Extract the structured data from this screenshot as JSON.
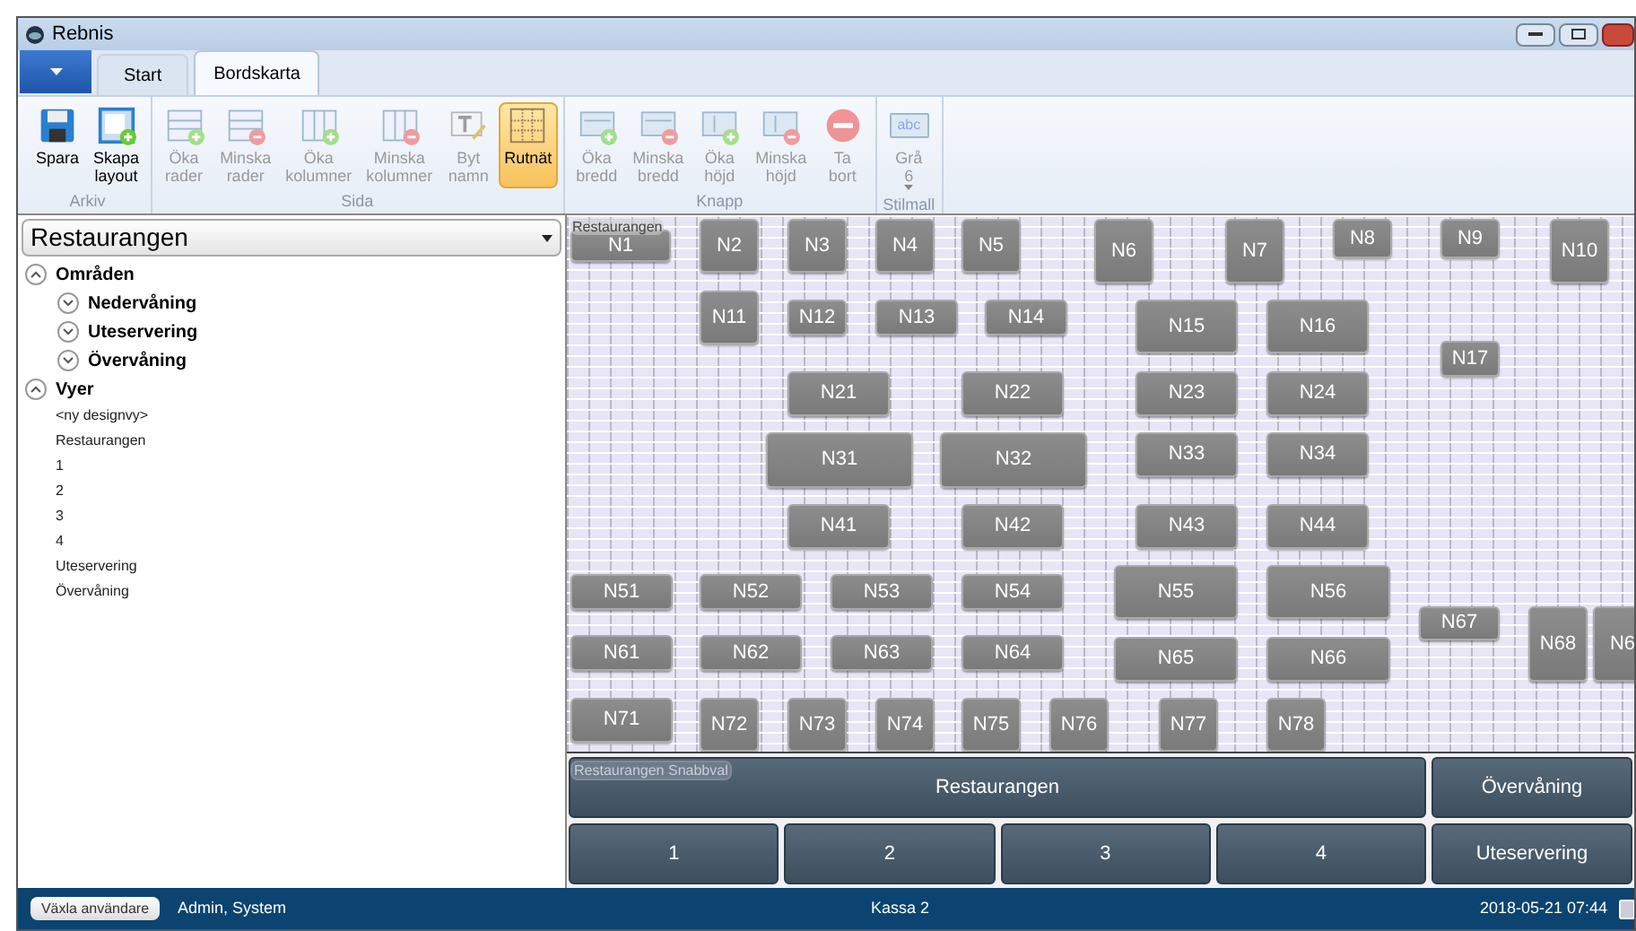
{
  "window": {
    "title": "Rebnis"
  },
  "tabs": [
    {
      "label": "Start",
      "selected": false
    },
    {
      "label": "Bordskarta",
      "selected": true
    }
  ],
  "ribbon": [
    {
      "group": "Arkiv",
      "buttons": [
        {
          "kind": "save",
          "lines": [
            "Spara"
          ],
          "disabled": false,
          "on": false
        },
        {
          "kind": "layout",
          "lines": [
            "Skapa",
            "layout"
          ],
          "disabled": false,
          "on": false
        }
      ]
    },
    {
      "group": "Sida",
      "buttons": [
        {
          "kind": "addrow",
          "lines": [
            "Öka",
            "rader"
          ],
          "disabled": true,
          "on": false
        },
        {
          "kind": "delrow",
          "lines": [
            "Minska",
            "rader"
          ],
          "disabled": true,
          "on": false
        },
        {
          "kind": "addcol",
          "lines": [
            "Öka",
            "kolumner"
          ],
          "disabled": true,
          "on": false
        },
        {
          "kind": "delcol",
          "lines": [
            "Minska",
            "kolumner"
          ],
          "disabled": true,
          "on": false
        },
        {
          "kind": "rename",
          "lines": [
            "Byt",
            "namn"
          ],
          "disabled": true,
          "on": false
        },
        {
          "kind": "grid",
          "lines": [
            "Rutnät"
          ],
          "disabled": false,
          "on": true
        }
      ]
    },
    {
      "group": "Knapp",
      "buttons": [
        {
          "kind": "addw",
          "lines": [
            "Öka",
            "bredd"
          ],
          "disabled": true,
          "on": false
        },
        {
          "kind": "delw",
          "lines": [
            "Minska",
            "bredd"
          ],
          "disabled": true,
          "on": false
        },
        {
          "kind": "addh",
          "lines": [
            "Öka",
            "höjd"
          ],
          "disabled": true,
          "on": false
        },
        {
          "kind": "delh",
          "lines": [
            "Minska",
            "höjd"
          ],
          "disabled": true,
          "on": false
        },
        {
          "kind": "remove",
          "lines": [
            "Ta",
            "bort"
          ],
          "disabled": true,
          "on": false
        }
      ]
    },
    {
      "group": "Stilmall",
      "buttons": [
        {
          "kind": "style",
          "icon_text": "abc",
          "lines": [
            "Grå",
            "6"
          ],
          "disabled": true,
          "on": false,
          "dropdown": true
        }
      ]
    }
  ],
  "area_select": {
    "value": "Restaurangen"
  },
  "tree": [
    {
      "label": "Områden",
      "expanded": true,
      "children": [
        {
          "label": "Nedervåning",
          "expanded": false
        },
        {
          "label": "Uteservering",
          "expanded": false
        },
        {
          "label": "Övervåning",
          "expanded": false
        }
      ]
    },
    {
      "label": "Vyer",
      "expanded": true,
      "items": [
        "<ny designvy>",
        "Restaurangen",
        "1",
        "2",
        "3",
        "4",
        "Uteservering",
        "Övervåning"
      ]
    }
  ],
  "canvas": {
    "area_label": "Restaurangen",
    "tables": [
      "N1",
      "N2",
      "N3",
      "N4",
      "N5",
      "N6",
      "N7",
      "N8",
      "N9",
      "N10",
      "N11",
      "N12",
      "N13",
      "N14",
      "N15",
      "N16",
      "N17",
      "N21",
      "N22",
      "N23",
      "N24",
      "N31",
      "N32",
      "N33",
      "N34",
      "N41",
      "N42",
      "N43",
      "N44",
      "N51",
      "N52",
      "N53",
      "N54",
      "N55",
      "N56",
      "N61",
      "N62",
      "N63",
      "N64",
      "N65",
      "N66",
      "N67",
      "N68",
      "N6",
      "N71",
      "N72",
      "N73",
      "N74",
      "N75",
      "N76",
      "N77",
      "N78"
    ]
  },
  "quick_select": {
    "label": "Restaurangen Snabbval",
    "main": [
      [
        "Restaurangen"
      ],
      [
        "1",
        "2",
        "3",
        "4"
      ]
    ],
    "side": [
      "Övervåning",
      "Uteservering"
    ]
  },
  "status_bar": {
    "button": "Växla användare",
    "user": "Admin, System",
    "register": "Kassa 2",
    "datetime": "2018-05-21 07:44"
  }
}
